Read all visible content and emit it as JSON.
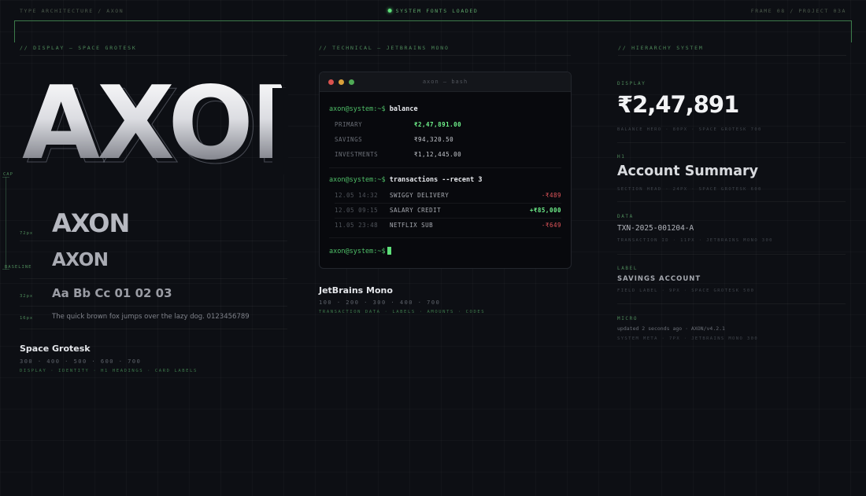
{
  "topbar": {
    "left": "TYPE ARCHITECTURE / AXON",
    "center": "SYSTEM FONTS LOADED",
    "right": "FRAME 08 / PROJECT 03A"
  },
  "colors": {
    "accent": "#5ee07a",
    "positive": "#6ef08a",
    "negative": "#e0555a",
    "background": "#0d0f14"
  },
  "display": {
    "section_label": "// DISPLAY — SPACE GROTESK",
    "hero": "AXON",
    "cap_label": "CAP",
    "baseline_label": "BASELINE",
    "samples": [
      {
        "size": "72px",
        "text": "AXON"
      },
      {
        "size": "",
        "text": "AXON"
      },
      {
        "size": "32px",
        "text": "Aa Bb Cc 01 02 03"
      },
      {
        "size": "16px",
        "text": "The quick brown fox jumps over the lazy dog. 0123456789"
      }
    ],
    "family": {
      "name": "Space Grotesk",
      "weights": "300 · 400 · 500 · 600 · 700",
      "uses": "DISPLAY · IDENTITY · H1 HEADINGS · CARD LABELS"
    }
  },
  "technical": {
    "section_label": "// TECHNICAL — JETBRAINS MONO",
    "terminal": {
      "title": "axon — bash",
      "prompt": "axon@system:~$",
      "cmd1": "balance",
      "balances": [
        {
          "label": "PRIMARY",
          "value": "₹2,47,891.00",
          "highlight": true
        },
        {
          "label": "SAVINGS",
          "value": "₹94,320.50",
          "highlight": false
        },
        {
          "label": "INVESTMENTS",
          "value": "₹1,12,445.00",
          "highlight": false
        }
      ],
      "cmd2": "transactions --recent 3",
      "transactions": [
        {
          "time": "12.05 14:32",
          "desc": "SWIGGY DELIVERY",
          "amount": "-₹489",
          "positive": false
        },
        {
          "time": "12.05 09:15",
          "desc": "SALARY CREDIT",
          "amount": "+₹85,000",
          "positive": true
        },
        {
          "time": "11.05 23:48",
          "desc": "NETFLIX SUB",
          "amount": "-₹649",
          "positive": false
        }
      ]
    },
    "family": {
      "name": "JetBrains Mono",
      "weights": "100 · 200 · 300 · 400 · 700",
      "uses": "TRANSACTION DATA · LABELS · AMOUNTS · CODES"
    }
  },
  "hierarchy": {
    "section_label": "// HIERARCHY SYSTEM",
    "levels": [
      {
        "label": "DISPLAY",
        "sample": "₹2,47,891",
        "meta": "BALANCE HERO · 80PX · SPACE GROTESK 700"
      },
      {
        "label": "H1",
        "sample": "Account Summary",
        "meta": "SECTION HEAD · 24PX · SPACE GROTESK 600"
      },
      {
        "label": "DATA",
        "sample": "TXN-2025-001204-A",
        "meta": "TRANSACTION ID · 11PX · JETBRAINS MONO 300"
      },
      {
        "label": "LABEL",
        "sample": "SAVINGS ACCOUNT",
        "meta": "FIELD LABEL · 9PX · SPACE GROTESK 500"
      },
      {
        "label": "MICRO",
        "sample": "updated 2 seconds ago · AXON/v4.2.1",
        "meta": "SYSTEM META · 7PX · JETBRAINS MONO 300"
      }
    ]
  }
}
